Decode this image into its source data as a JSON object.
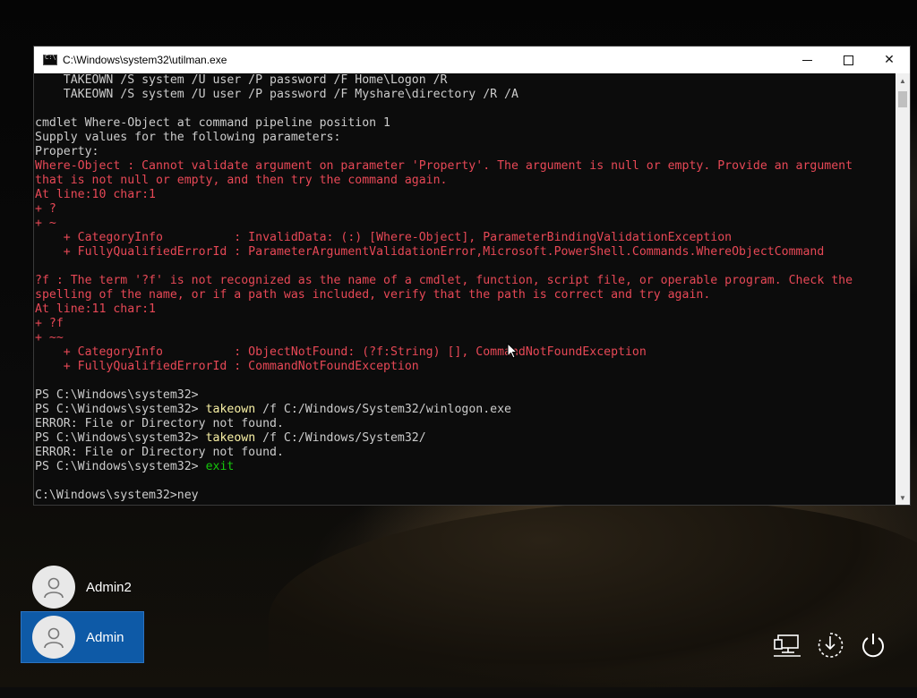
{
  "window": {
    "title": "C:\\Windows\\system32\\utilman.exe",
    "buttons": {
      "minimize": "",
      "maximize": "",
      "close": "✕"
    }
  },
  "console_lines": [
    {
      "text": "    TAKEOWN /S system /U user /P password /F Home\\Logon /R",
      "style": "normal"
    },
    {
      "text": "    TAKEOWN /S system /U user /P password /F Myshare\\directory /R /A",
      "style": "normal"
    },
    {
      "text": "",
      "style": "normal"
    },
    {
      "text": "cmdlet Where-Object at command pipeline position 1",
      "style": "normal"
    },
    {
      "text": "Supply values for the following parameters:",
      "style": "normal"
    },
    {
      "text": "Property:",
      "style": "normal"
    },
    {
      "text": "Where-Object : Cannot validate argument on parameter 'Property'. The argument is null or empty. Provide an argument",
      "style": "err"
    },
    {
      "text": "that is not null or empty, and then try the command again.",
      "style": "err"
    },
    {
      "text": "At line:10 char:1",
      "style": "err"
    },
    {
      "text": "+ ?",
      "style": "err"
    },
    {
      "text": "+ ~",
      "style": "err"
    },
    {
      "text": "    + CategoryInfo          : InvalidData: (:) [Where-Object], ParameterBindingValidationException",
      "style": "err"
    },
    {
      "text": "    + FullyQualifiedErrorId : ParameterArgumentValidationError,Microsoft.PowerShell.Commands.WhereObjectCommand",
      "style": "err"
    },
    {
      "text": "",
      "style": "normal"
    },
    {
      "text": "?f : The term '?f' is not recognized as the name of a cmdlet, function, script file, or operable program. Check the",
      "style": "err"
    },
    {
      "text": "spelling of the name, or if a path was included, verify that the path is correct and try again.",
      "style": "err"
    },
    {
      "text": "At line:11 char:1",
      "style": "err"
    },
    {
      "text": "+ ?f",
      "style": "err"
    },
    {
      "text": "+ ~~",
      "style": "err"
    },
    {
      "text": "    + CategoryInfo          : ObjectNotFound: (?f:String) [], CommandNotFoundException",
      "style": "err"
    },
    {
      "text": "    + FullyQualifiedErrorId : CommandNotFoundException",
      "style": "err"
    },
    {
      "text": "",
      "style": "normal"
    },
    {
      "text": "PS C:\\Windows\\system32>",
      "style": "normal"
    },
    {
      "prompt": "PS C:\\Windows\\system32> ",
      "cmd": "takeown",
      "args": " /f C:/Windows/System32/winlogon.exe",
      "cmd_style": "cmd"
    },
    {
      "text": "ERROR: File or Directory not found.",
      "style": "normal"
    },
    {
      "prompt": "PS C:\\Windows\\system32> ",
      "cmd": "takeown",
      "args": " /f C:/Windows/System32/",
      "cmd_style": "cmd"
    },
    {
      "text": "ERROR: File or Directory not found.",
      "style": "normal"
    },
    {
      "prompt": "PS C:\\Windows\\system32> ",
      "cmd": "exit",
      "args": "",
      "cmd_style": "grn"
    },
    {
      "text": "",
      "style": "normal"
    },
    {
      "text": "C:\\Windows\\system32>ney",
      "style": "normal"
    }
  ],
  "users": [
    {
      "name": "Admin2",
      "selected": false
    },
    {
      "name": "Admin",
      "selected": true
    }
  ],
  "system_icons": [
    "network-icon",
    "accessibility-icon",
    "power-icon"
  ],
  "colors": {
    "error": "#e74856",
    "command": "#f9f1a5",
    "exit_command": "#16c60c",
    "selected_user": "#0e5aa7"
  }
}
